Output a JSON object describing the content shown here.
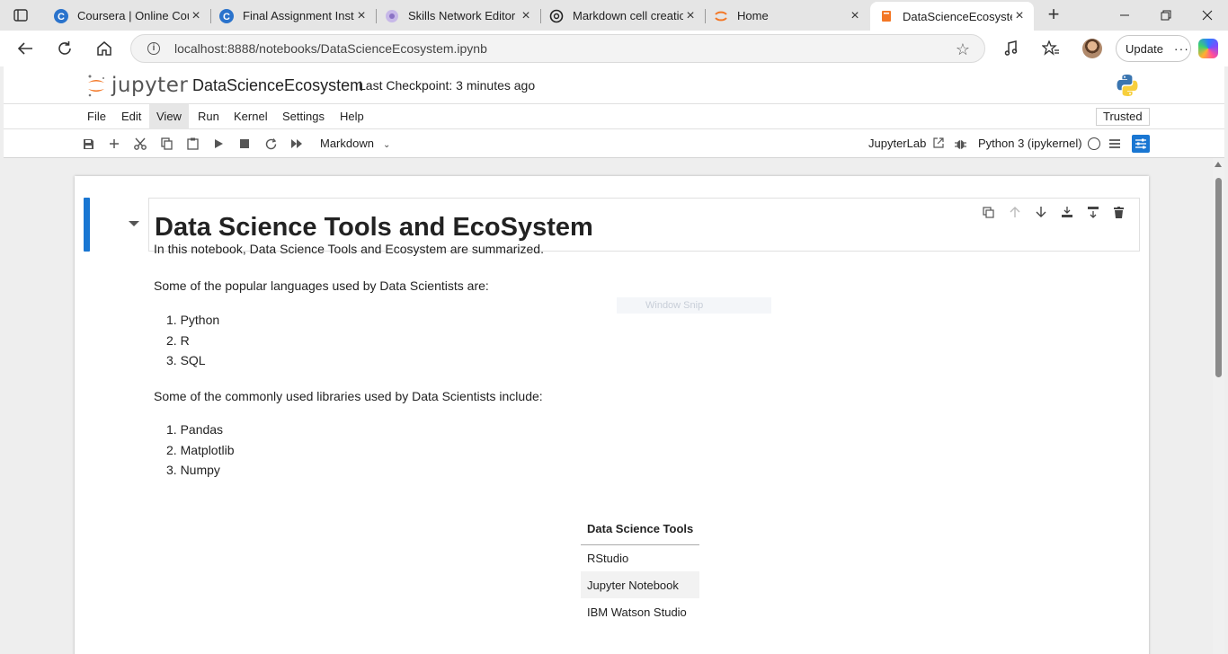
{
  "browser": {
    "tabs": [
      {
        "title": "Coursera | Online Cour",
        "favicon": "coursera-icon"
      },
      {
        "title": "Final Assignment Instru",
        "favicon": "coursera-icon"
      },
      {
        "title": "Skills Network Editor",
        "favicon": "skills-network-icon"
      },
      {
        "title": "Markdown cell creation",
        "favicon": "chatgpt-icon"
      },
      {
        "title": "Home",
        "favicon": "jupyter-icon"
      },
      {
        "title": "DataScienceEcosystem",
        "favicon": "notebook-icon",
        "active": true
      }
    ],
    "url": "localhost:8888/notebooks/DataScienceEcosystem.ipynb",
    "update_label": "Update",
    "more_label": "···"
  },
  "jupyter": {
    "logo_text": "jupyter",
    "notebook_name": "DataScienceEcosystem",
    "checkpoint": "Last Checkpoint: 3 minutes ago",
    "menu": [
      "File",
      "Edit",
      "View",
      "Run",
      "Kernel",
      "Settings",
      "Help"
    ],
    "trusted_label": "Trusted",
    "cell_type": "Markdown",
    "jupyterlab_label": "JupyterLab",
    "kernel_name": "Python 3 (ipykernel)"
  },
  "notebook": {
    "heading": "Data Science Tools and EcoSystem",
    "intro": "In this notebook, Data Science Tools and Ecosystem are summarized.",
    "languages_intro": "Some of the popular languages used by Data Scientists are:",
    "languages": [
      "1. Python",
      "2. R",
      "3. SQL"
    ],
    "libraries_intro": "Some of the commonly used libraries used by Data Scientists include:",
    "libraries": [
      "1. Pandas",
      "2. Matplotlib",
      "3. Numpy"
    ],
    "table": {
      "header": "Data Science Tools",
      "rows": [
        "RStudio",
        "Jupyter Notebook",
        "IBM Watson Studio"
      ]
    },
    "ghost_tooltip": "Window Snip"
  },
  "colors": {
    "cell_marker": "#1976d2",
    "jupyter_orange": "#f37726"
  }
}
